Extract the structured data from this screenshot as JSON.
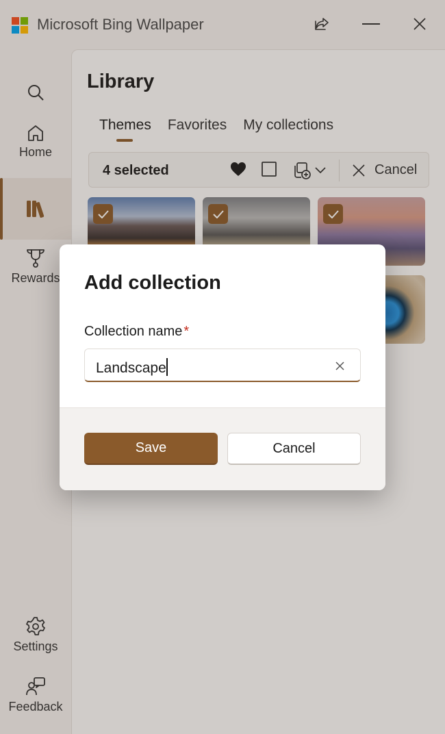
{
  "app": {
    "title": "Microsoft Bing Wallpaper"
  },
  "titlebar": {
    "share_icon": "share-icon",
    "minimize_icon": "minimize-icon",
    "close_icon": "close-icon"
  },
  "nav": {
    "items": [
      {
        "label": "",
        "icon": "search-icon"
      },
      {
        "label": "Home",
        "icon": "home-icon"
      },
      {
        "label": "",
        "icon": "library-icon",
        "active": true
      },
      {
        "label": "Rewards",
        "icon": "trophy-icon"
      },
      {
        "label": "Settings",
        "icon": "gear-icon"
      },
      {
        "label": "Feedback",
        "icon": "feedback-icon"
      }
    ]
  },
  "library": {
    "title": "Library",
    "tabs": [
      {
        "label": "Themes",
        "active": true
      },
      {
        "label": "Favorites"
      },
      {
        "label": "My collections"
      }
    ],
    "commandbar": {
      "selected_text": "4 selected",
      "cancel_label": "Cancel",
      "icons": [
        "heart-icon",
        "select-all-icon",
        "add-to-collection-icon",
        "chevron-down-icon",
        "close-icon"
      ]
    }
  },
  "dialog": {
    "title": "Add collection",
    "field_label": "Collection name",
    "required_mark": "*",
    "input_value": "Landscape",
    "save_label": "Save",
    "cancel_label": "Cancel"
  },
  "colors": {
    "accent": "#8a5a2b",
    "required": "#c42b1c"
  }
}
